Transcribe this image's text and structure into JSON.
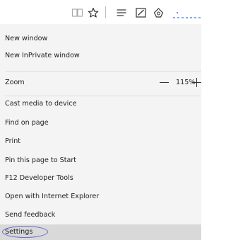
{
  "toolbar": {
    "icons": [
      "reading-view-icon",
      "favorite-star-icon",
      "hub-icon",
      "web-note-icon",
      "share-icon",
      "more-icon"
    ]
  },
  "menu": {
    "new_window": "New window",
    "new_inprivate_window": "New InPrivate window",
    "zoom_label": "Zoom",
    "zoom_value": "115%",
    "cast_media": "Cast media to device",
    "find_on_page": "Find on page",
    "print": "Print",
    "pin_to_start": "Pin this page to Start",
    "developer_tools": "F12 Developer Tools",
    "open_with_ie": "Open with Internet Explorer",
    "send_feedback": "Send feedback",
    "settings": "Settings"
  },
  "colors": {
    "menu_background": "#f4f4f4",
    "settings_highlight": "#d9d9d9",
    "annotation_ellipse": "#6a6ad0",
    "toolbar_accent": "#3b78d8"
  }
}
